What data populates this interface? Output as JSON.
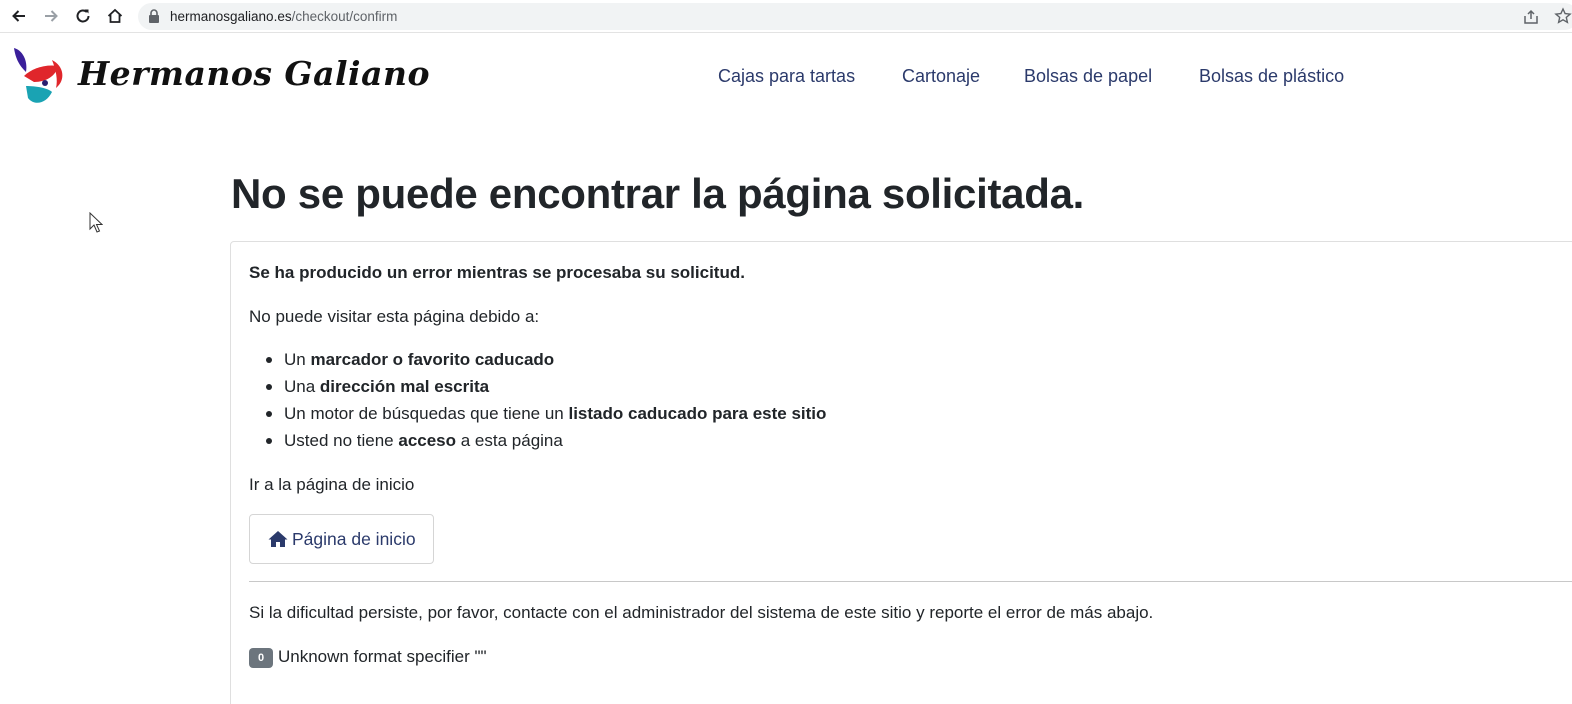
{
  "browser": {
    "url_host": "hermanosgaliano.es",
    "url_path": "/checkout/confirm"
  },
  "site": {
    "brand": "Hermanos Galiano",
    "menu": [
      "Cajas para tartas",
      "Cartonaje",
      "Bolsas de papel",
      "Bolsas de plástico"
    ]
  },
  "error_page": {
    "title": "No se puede encontrar la página solicitada.",
    "lead": "Se ha producido un error mientras se procesaba su solicitud.",
    "intro": "No puede visitar esta página debido a:",
    "reasons": [
      {
        "pre": "Un ",
        "bold": "marcador o favorito caducado",
        "post": ""
      },
      {
        "pre": "Una ",
        "bold": "dirección mal escrita",
        "post": ""
      },
      {
        "pre": "Un motor de búsquedas que tiene un ",
        "bold": "listado caducado para este sitio",
        "post": ""
      },
      {
        "pre": "Usted no tiene ",
        "bold": "acceso",
        "post": " a esta página"
      }
    ],
    "home_prompt": "Ir a la página de inicio",
    "home_button": "Página de inicio",
    "persist_text": "Si la dificultad persiste, por favor, contacte con el administrador del sistema de este sitio y reporte el error de más abajo.",
    "error_code": "0",
    "error_message": "Unknown format specifier \"\""
  }
}
